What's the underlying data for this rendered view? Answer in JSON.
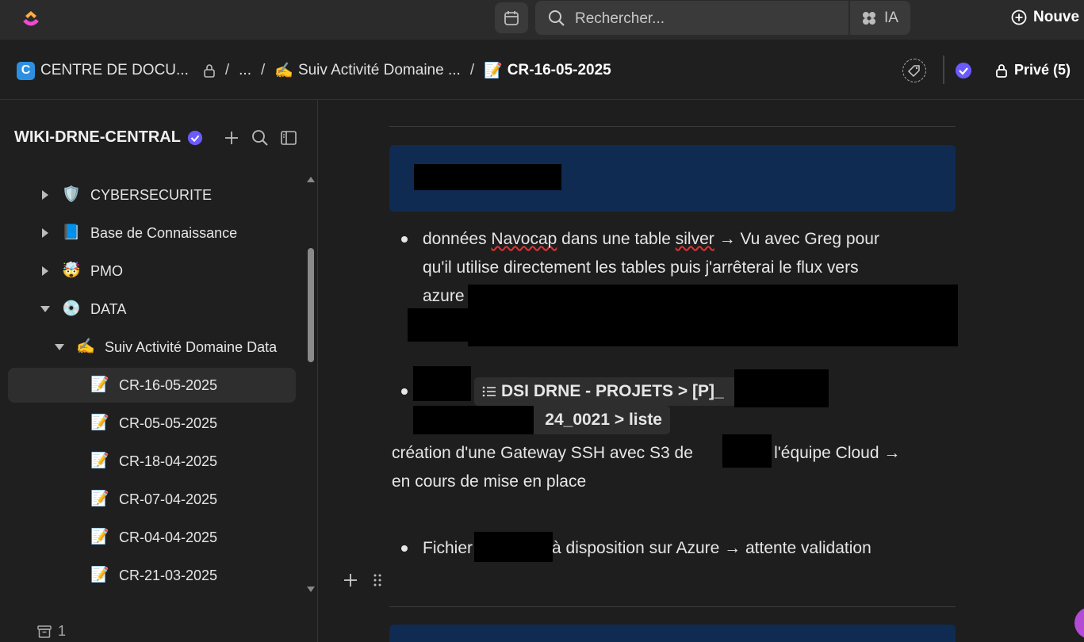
{
  "topbar": {
    "search_placeholder": "Rechercher...",
    "ai_label": "IA",
    "new_label": "Nouve"
  },
  "breadcrumb": {
    "space_badge": "C",
    "space": "CENTRE DE DOCU...",
    "ellipsis": "...",
    "parent_emoji": "✍️",
    "parent": "Suiv Activité Domaine ...",
    "current_emoji": "📝",
    "current": "CR-16-05-2025",
    "privacy_label": "Privé (5)"
  },
  "sidebar": {
    "title": "WIKI-DRNE-CENTRAL",
    "items": [
      {
        "label": "CYBERSECURITE",
        "emoji": "🛡️"
      },
      {
        "label": "Base de Connaissance",
        "emoji": "📘"
      },
      {
        "label": "PMO",
        "emoji": "🤯"
      },
      {
        "label": "DATA",
        "emoji": "💿"
      },
      {
        "label": "Suiv Activité Domaine Data",
        "emoji": "✍️"
      },
      {
        "label": "CR-16-05-2025",
        "emoji": "📝"
      },
      {
        "label": "CR-05-05-2025",
        "emoji": "📝"
      },
      {
        "label": "CR-18-04-2025",
        "emoji": "📝"
      },
      {
        "label": "CR-07-04-2025",
        "emoji": "📝"
      },
      {
        "label": "CR-04-04-2025",
        "emoji": "📝"
      },
      {
        "label": "CR-21-03-2025",
        "emoji": "📝"
      }
    ],
    "archive_count": "1"
  },
  "content": {
    "bullet1_part1": "données ",
    "bullet1_misspelled1": "Navocap",
    "bullet1_part2": " dans une table ",
    "bullet1_misspelled2": "silver",
    "bullet1_part3": " → Vu avec Greg pour",
    "bullet1_line2": "qu'il utilise directement les tables puis j'arrêterai le flux vers",
    "bullet1_line3": "azure",
    "chip_line1": "DSI DRNE - PROJETS > [P]_",
    "chip_line2": "24_0021 > liste",
    "para_part1": "création d'une Gateway SSH avec S3 de",
    "para_part2": "par l'équipe Cloud →",
    "para_line2": "en cours de mise en place",
    "bullet3_part1": "Fichier",
    "bullet3_part2": "à disposition sur Azure → attente validation"
  },
  "colors": {
    "banner": "#0f2b52",
    "accent_verified": "#6b5bff",
    "space_badge": "#2d8fe0"
  }
}
